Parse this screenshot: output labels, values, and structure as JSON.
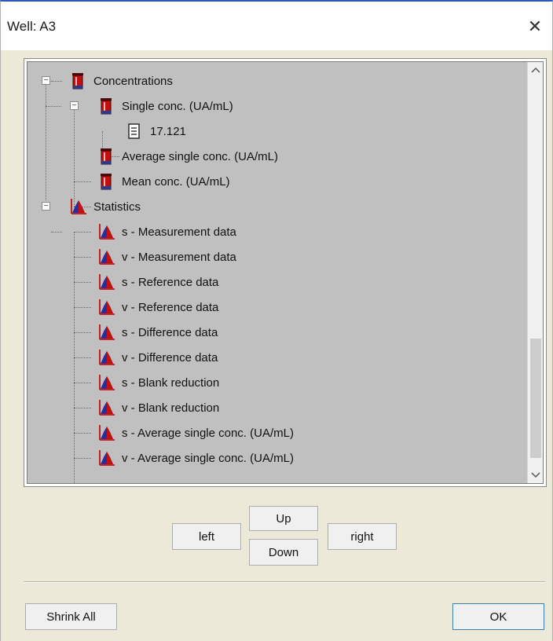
{
  "window": {
    "title": "Well: A3",
    "close_glyph": "✕"
  },
  "tree": {
    "nodes": [
      {
        "label": "Concentrations",
        "icon": "beaker-icon",
        "expander": "−"
      },
      {
        "label": "Single conc. (UA/mL)",
        "icon": "beaker-icon",
        "expander": "−"
      },
      {
        "label": "17.121",
        "icon": "document-icon"
      },
      {
        "label": "Average single conc. (UA/mL)",
        "icon": "beaker-icon"
      },
      {
        "label": "Mean conc. (UA/mL)",
        "icon": "beaker-icon"
      },
      {
        "label": "Statistics",
        "icon": "distribution-chart-icon",
        "expander": "−"
      },
      {
        "label": "s - Measurement data",
        "icon": "distribution-chart-icon"
      },
      {
        "label": "v - Measurement data",
        "icon": "distribution-chart-icon"
      },
      {
        "label": "s - Reference data",
        "icon": "distribution-chart-icon"
      },
      {
        "label": "v - Reference data",
        "icon": "distribution-chart-icon"
      },
      {
        "label": "s - Difference data",
        "icon": "distribution-chart-icon"
      },
      {
        "label": "v - Difference data",
        "icon": "distribution-chart-icon"
      },
      {
        "label": "s - Blank reduction",
        "icon": "distribution-chart-icon"
      },
      {
        "label": "v - Blank reduction",
        "icon": "distribution-chart-icon"
      },
      {
        "label": "s - Average single conc. (UA/mL)",
        "icon": "distribution-chart-icon"
      },
      {
        "label": "v - Average single conc. (UA/mL)",
        "icon": "distribution-chart-icon"
      }
    ]
  },
  "scrollbar": {
    "up_glyph": "^",
    "down_glyph": "v"
  },
  "nav_buttons": {
    "up": "Up",
    "down": "Down",
    "left": "left",
    "right": "right"
  },
  "footer": {
    "shrink_all": "Shrink All",
    "ok": "OK"
  },
  "colors": {
    "title_accent": "#2c57b8",
    "tree_background": "#c0c0c0",
    "dialog_background": "#ece9d8"
  }
}
